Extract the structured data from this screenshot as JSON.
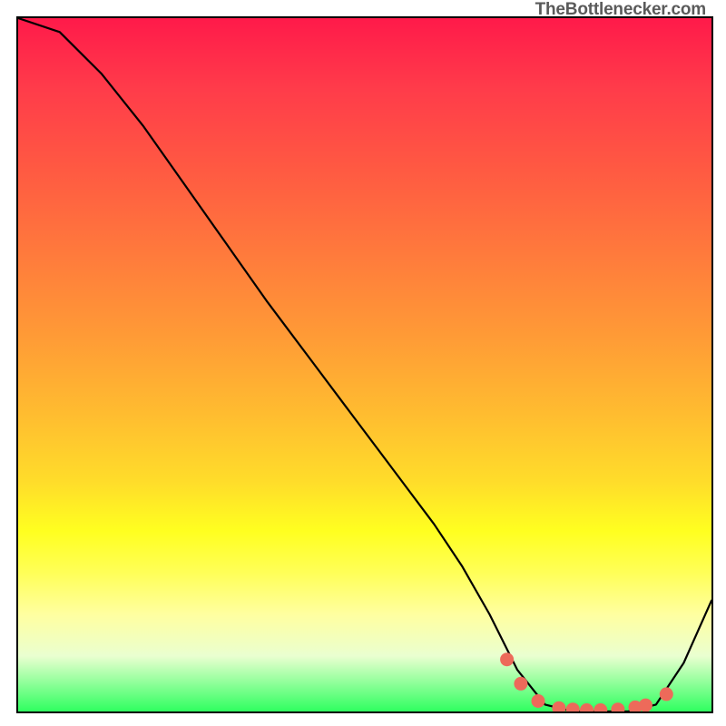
{
  "watermark": "TheBottlenecker.com",
  "chart_data": {
    "type": "line",
    "title": "",
    "xlabel": "",
    "ylabel": "",
    "xlim": [
      0,
      100
    ],
    "ylim": [
      0,
      100
    ],
    "grid": false,
    "legend": false,
    "series": [
      {
        "name": "bottleneck-curve",
        "x": [
          0,
          6,
          12,
          18,
          24,
          30,
          36,
          42,
          48,
          54,
          60,
          64,
          68,
          72,
          76,
          80,
          84,
          88,
          92,
          96,
          100
        ],
        "values": [
          100,
          98,
          92,
          84.5,
          76,
          67.5,
          59,
          51,
          43,
          35,
          27,
          21,
          14,
          6,
          1,
          0,
          0,
          0,
          1,
          7,
          16
        ]
      }
    ],
    "markers": {
      "name": "highlight-points",
      "color": "#ed6a5a",
      "points": [
        {
          "x": 70.5,
          "y": 7.5
        },
        {
          "x": 72.5,
          "y": 4.0
        },
        {
          "x": 75.0,
          "y": 1.5
        },
        {
          "x": 78.0,
          "y": 0.5
        },
        {
          "x": 80.0,
          "y": 0.3
        },
        {
          "x": 82.0,
          "y": 0.2
        },
        {
          "x": 84.0,
          "y": 0.2
        },
        {
          "x": 86.5,
          "y": 0.3
        },
        {
          "x": 89.0,
          "y": 0.6
        },
        {
          "x": 90.5,
          "y": 0.9
        },
        {
          "x": 93.5,
          "y": 2.5
        }
      ]
    },
    "gradient_stops": [
      {
        "pos": 0.0,
        "color": "#ff1a4a"
      },
      {
        "pos": 0.5,
        "color": "#ffb030"
      },
      {
        "pos": 0.78,
        "color": "#ffff20"
      },
      {
        "pos": 1.0,
        "color": "#2fff60"
      }
    ]
  }
}
